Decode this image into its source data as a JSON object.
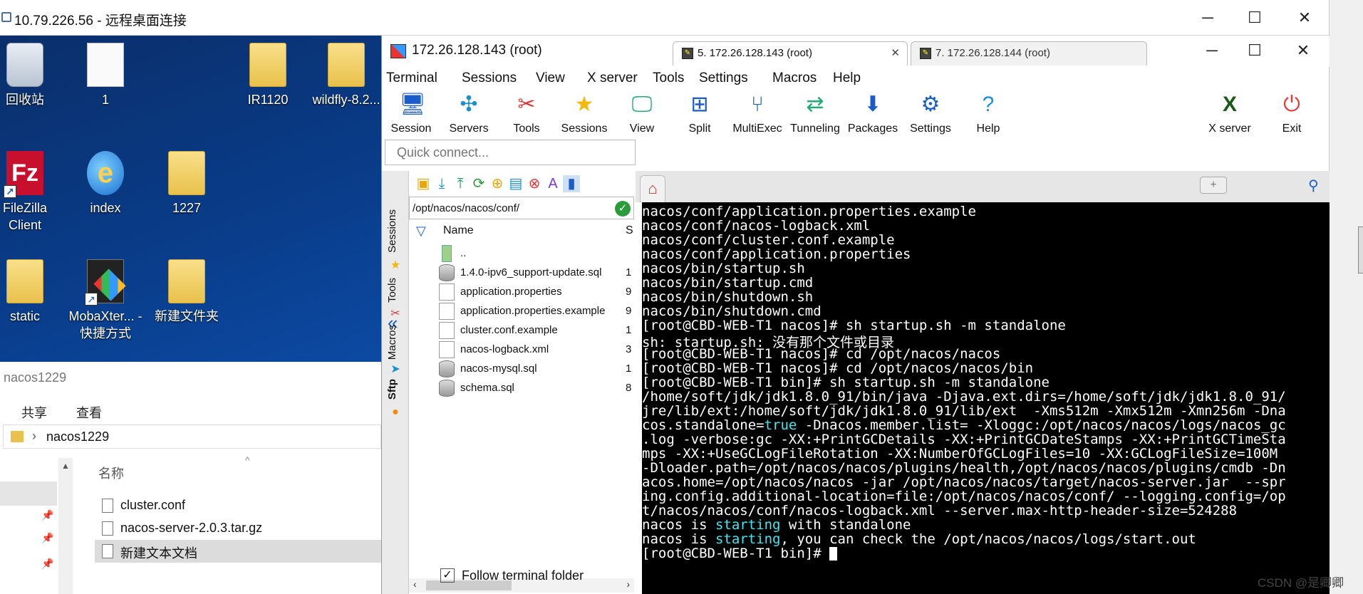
{
  "remote_desktop": {
    "title": "10.79.226.56 - 远程桌面连接",
    "minimize": "─",
    "maximize": "☐",
    "close": "✕"
  },
  "desktop": {
    "icons": [
      {
        "label": "回收站",
        "icon": "recycle-bin-icon"
      },
      {
        "label": "1",
        "icon": "file-icon"
      },
      {
        "label": "IR1120",
        "icon": "zip-folder-icon"
      },
      {
        "label": "wildfly-8.2...",
        "icon": "zip-folder-icon"
      },
      {
        "label": "FileZilla Client",
        "icon": "filezilla-icon"
      },
      {
        "label": "index",
        "icon": "internet-explorer-icon"
      },
      {
        "label": "1227",
        "icon": "folder-icon"
      },
      {
        "label": "static",
        "icon": "zip-folder-icon"
      },
      {
        "label": "MobaXter... - 快捷方式",
        "icon": "mobaxterm-icon"
      },
      {
        "label": "新建文件夹",
        "icon": "folder-icon"
      }
    ]
  },
  "explorer": {
    "title": "nacos1229",
    "ribbon": [
      "共享",
      "查看"
    ],
    "address": "nacos1229",
    "column_name": "名称",
    "files": [
      "cluster.conf",
      "nacos-server-2.0.3.tar.gz",
      "新建文本文档"
    ]
  },
  "moba": {
    "title": "172.26.128.143 (root)",
    "minimize": "─",
    "maximize": "☐",
    "close": "✕",
    "menu": [
      "Terminal",
      "Sessions",
      "View",
      "X server",
      "Tools",
      "Settings",
      "Macros",
      "Help"
    ],
    "toolbar": [
      {
        "label": "Session",
        "icon": "session-icon"
      },
      {
        "label": "Servers",
        "icon": "servers-icon"
      },
      {
        "label": "Tools",
        "icon": "tools-icon"
      },
      {
        "label": "Sessions",
        "icon": "star-icon"
      },
      {
        "label": "View",
        "icon": "view-icon"
      },
      {
        "label": "Split",
        "icon": "split-icon"
      },
      {
        "label": "MultiExec",
        "icon": "multiexec-icon"
      },
      {
        "label": "Tunneling",
        "icon": "tunneling-icon"
      },
      {
        "label": "Packages",
        "icon": "packages-icon"
      },
      {
        "label": "Settings",
        "icon": "settings-icon"
      },
      {
        "label": "Help",
        "icon": "help-icon"
      },
      {
        "label": "X server",
        "icon": "x-server-icon"
      },
      {
        "label": "Exit",
        "icon": "exit-icon"
      }
    ],
    "quick_connect_placeholder": "Quick connect...",
    "side_tabs": [
      "Sessions",
      "Tools",
      "Macros",
      "Sftp"
    ],
    "sftp": {
      "path": "/opt/nacos/nacos/conf/",
      "col_name": "Name",
      "col_size": "S",
      "files": [
        {
          "name": "..",
          "size": ""
        },
        {
          "name": "1.4.0-ipv6_support-update.sql",
          "size": "1"
        },
        {
          "name": "application.properties",
          "size": "9"
        },
        {
          "name": "application.properties.example",
          "size": "9"
        },
        {
          "name": "cluster.conf.example",
          "size": "1"
        },
        {
          "name": "nacos-logback.xml",
          "size": "3"
        },
        {
          "name": "nacos-mysql.sql",
          "size": "1"
        },
        {
          "name": "schema.sql",
          "size": "8"
        }
      ],
      "follow_label": "Follow terminal folder",
      "follow_checked": true
    },
    "tabs": [
      {
        "label": "5. 172.26.128.143 (root)",
        "active": true
      },
      {
        "label": "7. 172.26.128.144 (root)",
        "active": false
      }
    ],
    "terminal_lines": [
      "nacos/conf/application.properties.example",
      "nacos/conf/nacos-logback.xml",
      "nacos/conf/cluster.conf.example",
      "nacos/conf/application.properties",
      "nacos/bin/startup.sh",
      "nacos/bin/startup.cmd",
      "nacos/bin/shutdown.sh",
      "nacos/bin/shutdown.cmd",
      "[root@CBD-WEB-T1 nacos]# sh startup.sh -m standalone",
      "sh: startup.sh: 没有那个文件或目录",
      "[root@CBD-WEB-T1 nacos]# cd /opt/nacos/nacos",
      "[root@CBD-WEB-T1 nacos]# cd /opt/nacos/nacos/bin",
      "[root@CBD-WEB-T1 bin]# sh startup.sh -m standalone",
      "/home/soft/jdk/jdk1.8.0_91/bin/java -Djava.ext.dirs=/home/soft/jdk/jdk1.8.0_91/",
      "jre/lib/ext:/home/soft/jdk/jdk1.8.0_91/lib/ext  -Xms512m -Xmx512m -Xmn256m -Dna",
      "cos.standalone=true -Dnacos.member.list= -Xloggc:/opt/nacos/nacos/logs/nacos_gc",
      ".log -verbose:gc -XX:+PrintGCDetails -XX:+PrintGCDateStamps -XX:+PrintGCTimeSta",
      "mps -XX:+UseGCLogFileRotation -XX:NumberOfGCLogFiles=10 -XX:GCLogFileSize=100M",
      "-Dloader.path=/opt/nacos/nacos/plugins/health,/opt/nacos/nacos/plugins/cmdb -Dn",
      "acos.home=/opt/nacos/nacos -jar /opt/nacos/nacos/target/nacos-server.jar  --spr",
      "ing.config.additional-location=file:/opt/nacos/nacos/conf/ --logging.config=/op",
      "t/nacos/nacos/conf/nacos-logback.xml --server.max-http-header-size=524288",
      "nacos is starting with standalone",
      "nacos is starting, you can check the /opt/nacos/nacos/logs/start.out",
      "[root@CBD-WEB-T1 bin]# "
    ],
    "highlight_color": "#3ee8f0"
  },
  "watermark": "CSDN @是卿卿"
}
